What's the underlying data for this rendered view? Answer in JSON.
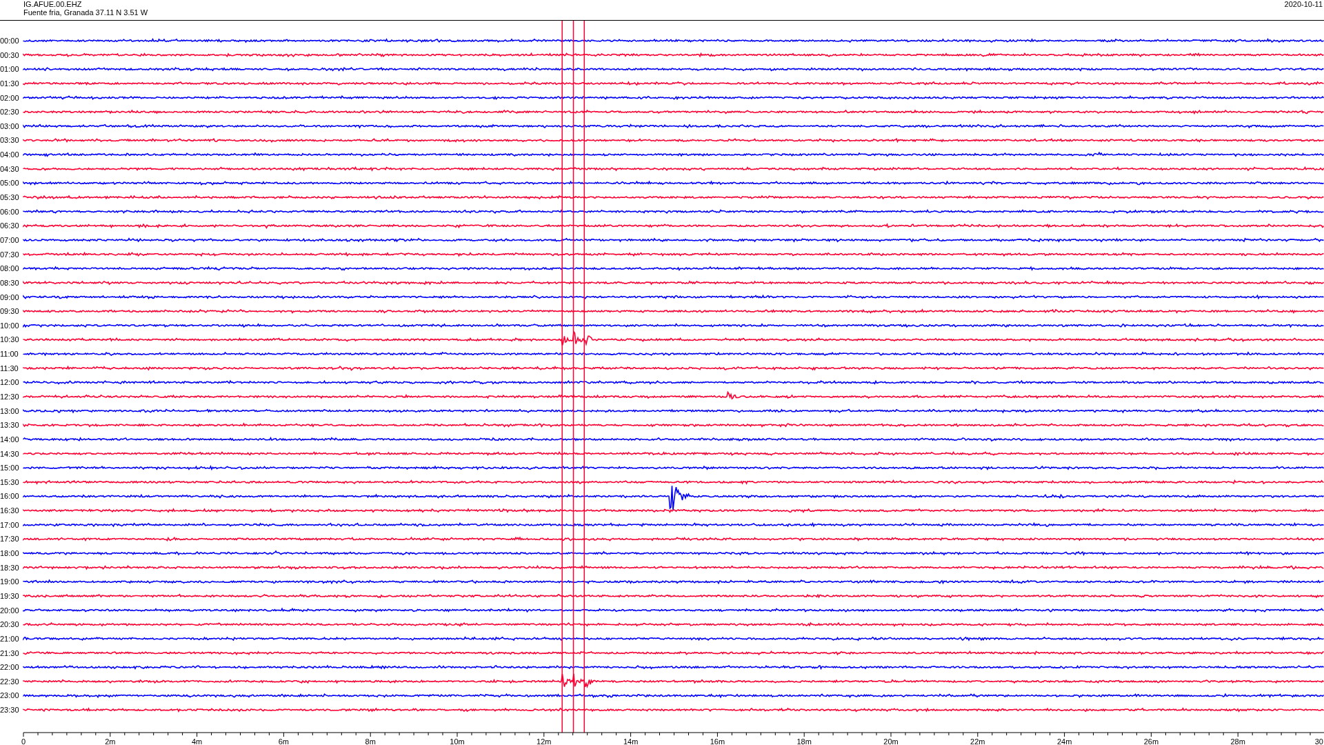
{
  "header": {
    "station": "IG.AFUE.00.EHZ",
    "location": "Fuente fria, Granada  37.11 N 3.51 W",
    "date": "2020-10-11"
  },
  "traces": [
    {
      "label": "00:00",
      "color": "#0000ff"
    },
    {
      "label": "00:30",
      "color": "#ff0033"
    },
    {
      "label": "01:00",
      "color": "#0000ff"
    },
    {
      "label": "01:30",
      "color": "#ff0033"
    },
    {
      "label": "02:00",
      "color": "#0000ff"
    },
    {
      "label": "02:30",
      "color": "#ff0033"
    },
    {
      "label": "03:00",
      "color": "#0000ff"
    },
    {
      "label": "03:30",
      "color": "#ff0033"
    },
    {
      "label": "04:00",
      "color": "#0000ff"
    },
    {
      "label": "04:30",
      "color": "#ff0033"
    },
    {
      "label": "05:00",
      "color": "#0000ff"
    },
    {
      "label": "05:30",
      "color": "#ff0033"
    },
    {
      "label": "06:00",
      "color": "#0000ff"
    },
    {
      "label": "06:30",
      "color": "#ff0033"
    },
    {
      "label": "07:00",
      "color": "#0000ff"
    },
    {
      "label": "07:30",
      "color": "#ff0033"
    },
    {
      "label": "08:00",
      "color": "#0000ff"
    },
    {
      "label": "08:30",
      "color": "#ff0033"
    },
    {
      "label": "09:00",
      "color": "#0000ff"
    },
    {
      "label": "09:30",
      "color": "#ff0033"
    },
    {
      "label": "10:00",
      "color": "#0000ff"
    },
    {
      "label": "10:30",
      "color": "#ff0033"
    },
    {
      "label": "11:00",
      "color": "#0000ff"
    },
    {
      "label": "11:30",
      "color": "#ff0033"
    },
    {
      "label": "12:00",
      "color": "#0000ff"
    },
    {
      "label": "12:30",
      "color": "#ff0033"
    },
    {
      "label": "13:00",
      "color": "#0000ff"
    },
    {
      "label": "13:30",
      "color": "#ff0033"
    },
    {
      "label": "14:00",
      "color": "#0000ff"
    },
    {
      "label": "14:30",
      "color": "#ff0033"
    },
    {
      "label": "15:00",
      "color": "#0000ff"
    },
    {
      "label": "15:30",
      "color": "#ff0033"
    },
    {
      "label": "16:00",
      "color": "#0000ff"
    },
    {
      "label": "16:30",
      "color": "#ff0033"
    },
    {
      "label": "17:00",
      "color": "#0000ff"
    },
    {
      "label": "17:30",
      "color": "#ff0033"
    },
    {
      "label": "18:00",
      "color": "#0000ff"
    },
    {
      "label": "18:30",
      "color": "#ff0033"
    },
    {
      "label": "19:00",
      "color": "#0000ff"
    },
    {
      "label": "19:30",
      "color": "#ff0033"
    },
    {
      "label": "20:00",
      "color": "#0000ff"
    },
    {
      "label": "20:30",
      "color": "#ff0033"
    },
    {
      "label": "21:00",
      "color": "#0000ff"
    },
    {
      "label": "21:30",
      "color": "#ff0033"
    },
    {
      "label": "22:00",
      "color": "#0000ff"
    },
    {
      "label": "22:30",
      "color": "#ff0033"
    },
    {
      "label": "23:00",
      "color": "#0000ff"
    },
    {
      "label": "23:30",
      "color": "#ff0033"
    }
  ],
  "axis": {
    "ticks": [
      "0",
      "2m",
      "4m",
      "6m",
      "8m",
      "10m",
      "12m",
      "14m",
      "16m",
      "18m",
      "20m",
      "22m",
      "24m",
      "26m",
      "28m",
      "30"
    ]
  }
}
